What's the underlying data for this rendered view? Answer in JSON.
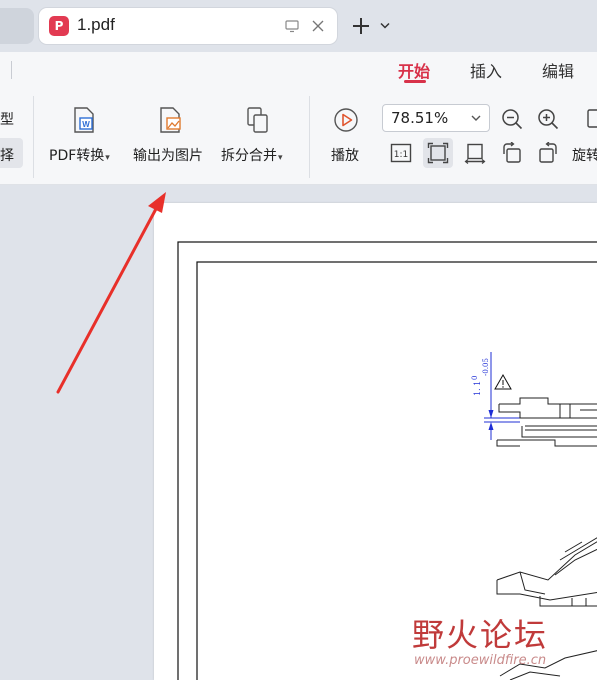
{
  "tabs": {
    "active_title": "1.pdf",
    "badge_glyph": "P",
    "icons": [
      "pdf-app-icon",
      "monitor-icon",
      "close-icon",
      "plus-icon",
      "chevron-down-icon"
    ]
  },
  "menu": {
    "start": "开始",
    "insert": "插入",
    "edit": "编辑",
    "active": "开始",
    "accent_color": "#d8324a"
  },
  "ribbon": {
    "left_type": "型",
    "left_select": "择",
    "pdf_convert": "PDF转换",
    "export_image": "输出为图片",
    "split_merge": "拆分合并",
    "play": "播放",
    "rotate": "旋转",
    "zoom_value": "78.51%",
    "actual_size_glyph": "1:1"
  },
  "drawing": {
    "dimension_top": "0",
    "dimension_bottom": "-0.05",
    "dimension_main": "1. 1"
  },
  "watermark": {
    "text": "野火论坛",
    "url": "www.proewildfire.cn"
  }
}
